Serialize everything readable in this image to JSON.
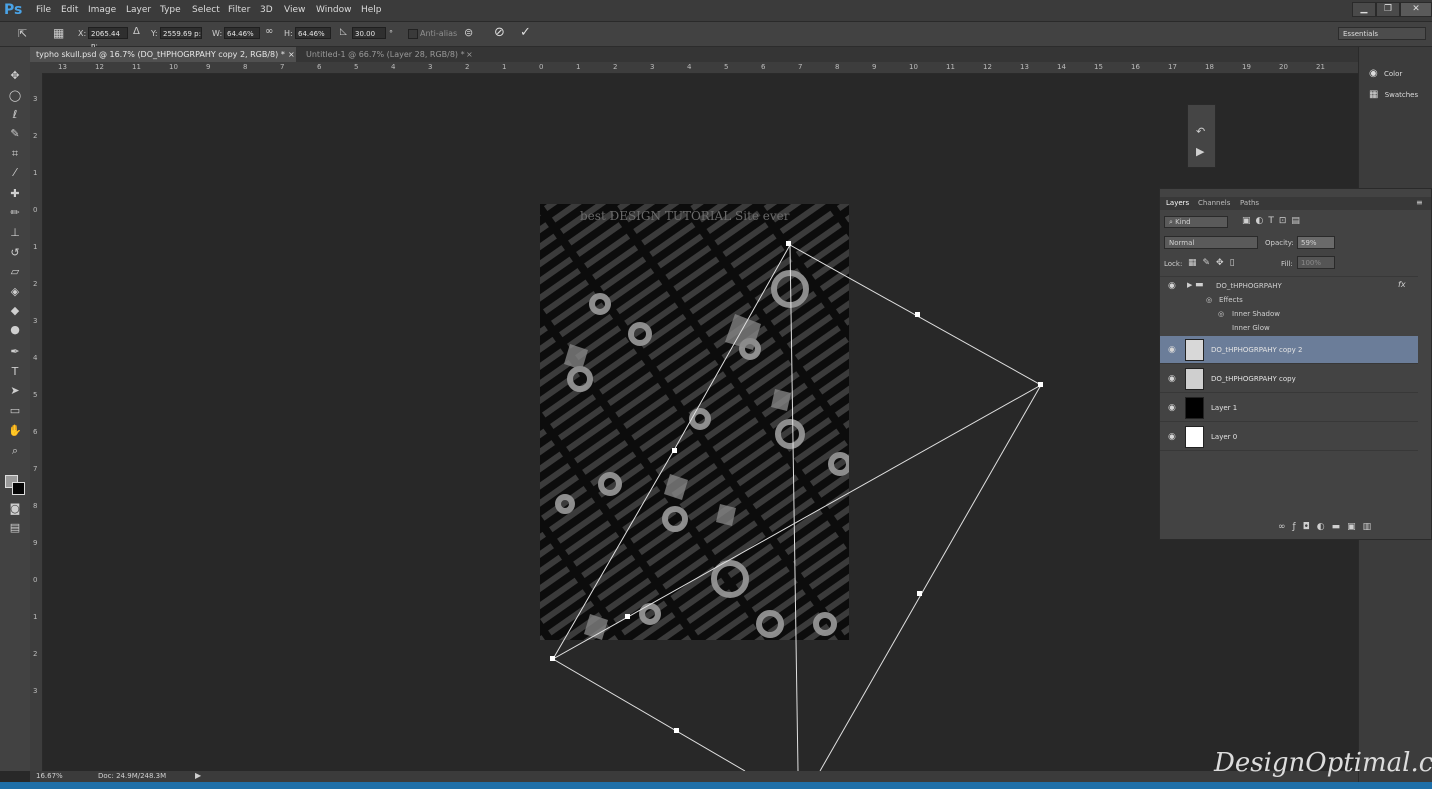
{
  "app": {
    "logo": "Ps"
  },
  "menu": [
    "File",
    "Edit",
    "Image",
    "Layer",
    "Type",
    "Select",
    "Filter",
    "3D",
    "View",
    "Window",
    "Help"
  ],
  "window_controls": {
    "minimize": "▁",
    "restore": "❐",
    "close": "✕"
  },
  "options_bar": {
    "x_label": "X:",
    "x_value": "2065.44 p:",
    "y_label": "Y:",
    "y_value": "2559.69 p:",
    "w_label": "W:",
    "w_value": "64.46%",
    "h_label": "H:",
    "h_value": "64.46%",
    "angle_value": "30.00",
    "degree": "°",
    "antialias_label": "Anti-alias",
    "workspace": "Essentials"
  },
  "tabs": [
    {
      "label": "typho skull.psd @ 16.7% (DO_tHPHOGRPAHY copy 2, RGB/8) *",
      "close": "×"
    },
    {
      "label": "Untitled-1 @ 66.7% (Layer 28, RGB/8) *",
      "close": "×"
    }
  ],
  "ruler_h": [
    "13",
    "12",
    "11",
    "10",
    "9",
    "8",
    "7",
    "6",
    "5",
    "4",
    "3",
    "2",
    "1",
    "0",
    "1",
    "2",
    "3",
    "4",
    "5",
    "6",
    "7",
    "8",
    "9",
    "10",
    "11",
    "12",
    "13",
    "14",
    "15",
    "16",
    "17",
    "18",
    "19",
    "20",
    "21"
  ],
  "ruler_v": [
    "3",
    "2",
    "1",
    "0",
    "1",
    "2",
    "3",
    "4",
    "5",
    "6",
    "7",
    "8",
    "9",
    "0",
    "1",
    "2",
    "3"
  ],
  "canvas_text": {
    "title": "best DESIGN TUTORIAL Site ever",
    "words": "TUTORIAL DESIGN best"
  },
  "status": {
    "zoom": "16.67%",
    "doc": "Doc: 24.9M/248.3M"
  },
  "dock": {
    "color": "Color",
    "swatches": "Swatches"
  },
  "layers_panel": {
    "tabs": [
      "Layers",
      "Channels",
      "Paths"
    ],
    "kind": "Kind",
    "blend_mode": "Normal",
    "opacity_label": "Opacity:",
    "opacity_value": "59%",
    "lock_label": "Lock:",
    "fill_label": "Fill:",
    "fill_value": "100%",
    "group": {
      "name": "DO_tHPHOGRPAHY",
      "fx": "fx",
      "effects_label": "Effects",
      "effects": [
        "Inner Shadow",
        "Inner Glow"
      ]
    },
    "layers": [
      {
        "name": "DO_tHPHOGRPAHY copy 2"
      },
      {
        "name": "DO_tHPHOGRPAHY copy"
      },
      {
        "name": "Layer 1"
      },
      {
        "name": "Layer 0"
      }
    ]
  },
  "watermark": "DesignOptimal.com"
}
